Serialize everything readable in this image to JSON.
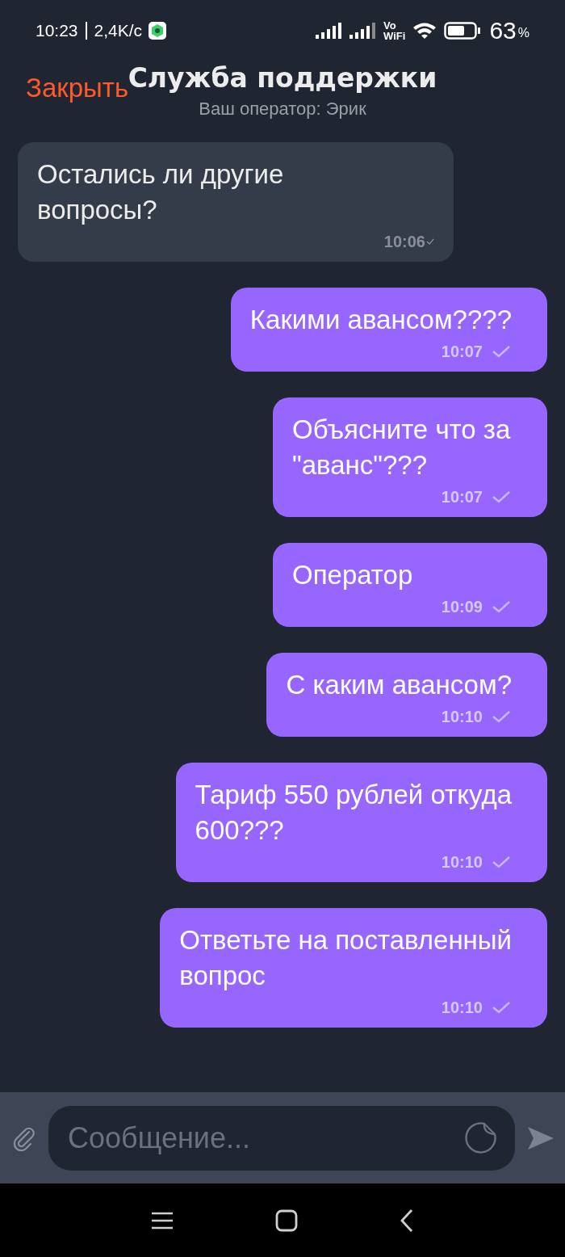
{
  "status_bar": {
    "time": "10:23",
    "speed": "2,4K/с",
    "vowifi": "Vo\nWiFi",
    "battery_percent": "63",
    "percent_sign": "%"
  },
  "header": {
    "close": "Закрыть",
    "title": "Служба поддержки",
    "subtitle": "Ваш оператор: Эрик"
  },
  "messages": [
    {
      "kind": "operator",
      "text": "Остались ли другие\nвопросы?",
      "time": "10:06"
    },
    {
      "kind": "user",
      "text": "Какими авансом????",
      "time": "10:07"
    },
    {
      "kind": "user",
      "text": "Объясните что за\n\"аванс\"???",
      "time": "10:07"
    },
    {
      "kind": "user",
      "text": "Оператор",
      "time": "10:09"
    },
    {
      "kind": "user",
      "text": "С каким авансом?",
      "time": "10:10"
    },
    {
      "kind": "user",
      "text": "Тариф 550 рублей откуда\n600???",
      "time": "10:10"
    },
    {
      "kind": "user",
      "text": "Ответьте на поставленный\nвопрос",
      "time": "10:10"
    }
  ],
  "composer": {
    "placeholder": "Сообщение..."
  }
}
